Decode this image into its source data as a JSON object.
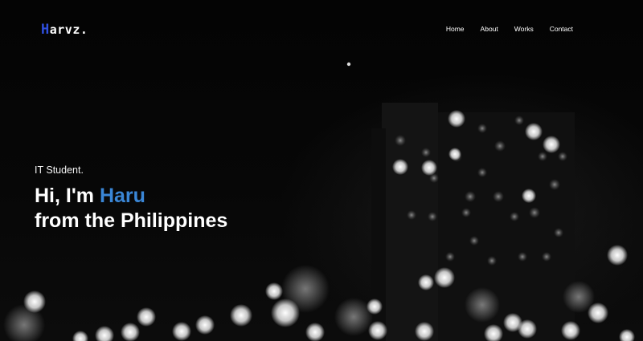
{
  "brand": {
    "logo_initial": "H",
    "logo_rest": "arvz.",
    "logo_initial_color": "#2f4fe0"
  },
  "nav": {
    "items": [
      {
        "label": "Home"
      },
      {
        "label": "About"
      },
      {
        "label": "Works"
      },
      {
        "label": "Contact"
      }
    ]
  },
  "hero": {
    "tagline": "IT Student.",
    "greeting": "Hi, I'm ",
    "name": "Haru",
    "name_color": "#3a86d6",
    "location_line": "from the Philippines",
    "background": "night city bokeh lights, black and white"
  }
}
